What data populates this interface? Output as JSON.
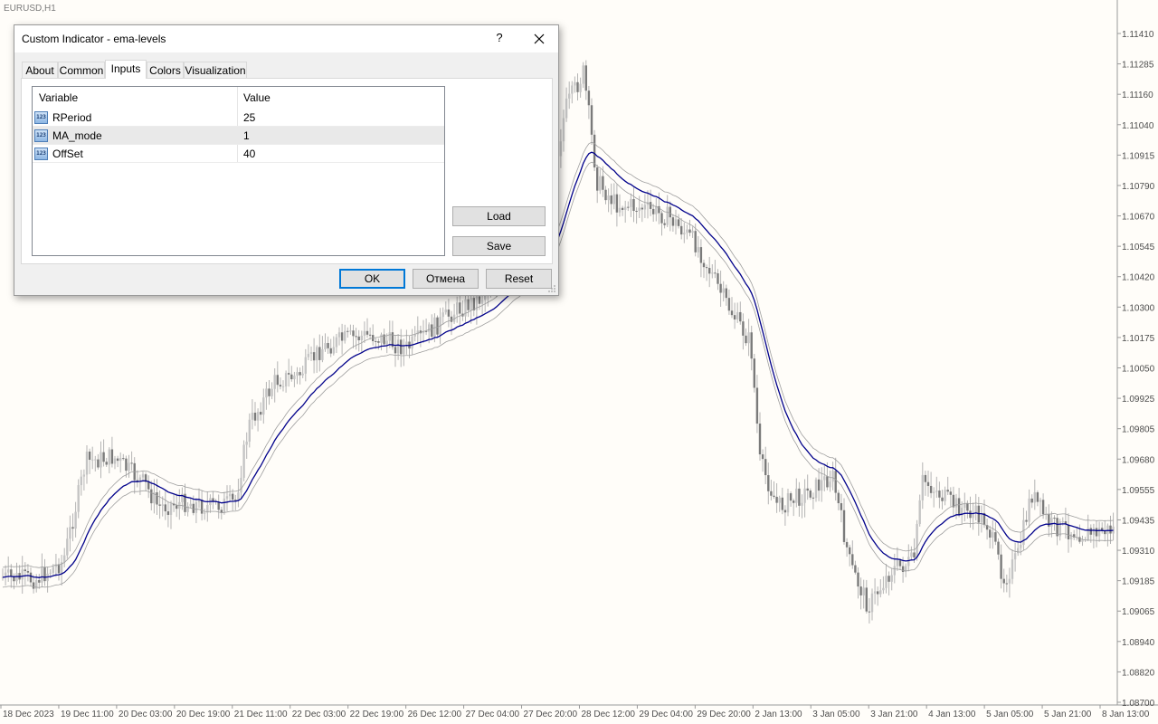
{
  "chart": {
    "symbol_label": "EURUSD,H1",
    "price_axis": [
      "1.11410",
      "1.11285",
      "1.11160",
      "1.11040",
      "1.10915",
      "1.10790",
      "1.10670",
      "1.10545",
      "1.10420",
      "1.10300",
      "1.10175",
      "1.10050",
      "1.09925",
      "1.09805",
      "1.09680",
      "1.09555",
      "1.09435",
      "1.09310",
      "1.09185",
      "1.09065",
      "1.08940",
      "1.08820",
      "1.08700"
    ],
    "time_axis": [
      "18 Dec 2023",
      "19 Dec 11:00",
      "20 Dec 03:00",
      "20 Dec 19:00",
      "21 Dec 11:00",
      "22 Dec 03:00",
      "22 Dec 19:00",
      "26 Dec 12:00",
      "27 Dec 04:00",
      "27 Dec 20:00",
      "28 Dec 12:00",
      "29 Dec 04:00",
      "29 Dec 20:00",
      "2 Jan 13:00",
      "3 Jan 05:00",
      "3 Jan 21:00",
      "4 Jan 13:00",
      "5 Jan 05:00",
      "5 Jan 21:00",
      "8 Jan 13:00"
    ],
    "colors": {
      "background": "#fffdf9",
      "candles": "#8c8c8c",
      "ema": "#00008b",
      "bands": "#9e9e9e",
      "axis_text": "#4d4d4d"
    }
  },
  "dialog": {
    "title": "Custom Indicator - ema-levels",
    "help_label": "?",
    "close_icon": "close-icon",
    "tabs": [
      {
        "label": "About"
      },
      {
        "label": "Common"
      },
      {
        "label": "Inputs",
        "active": true
      },
      {
        "label": "Colors"
      },
      {
        "label": "Visualization"
      }
    ],
    "grid": {
      "headers": {
        "variable": "Variable",
        "value": "Value"
      },
      "rows": [
        {
          "icon": "123",
          "name": "RPeriod",
          "value": "25"
        },
        {
          "icon": "123",
          "name": "MA_mode",
          "value": "1",
          "selected": true
        },
        {
          "icon": "123",
          "name": "OffSet",
          "value": "40"
        }
      ]
    },
    "buttons": {
      "load": "Load",
      "save": "Save",
      "ok": "OK",
      "cancel": "Отмена",
      "reset": "Reset"
    }
  }
}
